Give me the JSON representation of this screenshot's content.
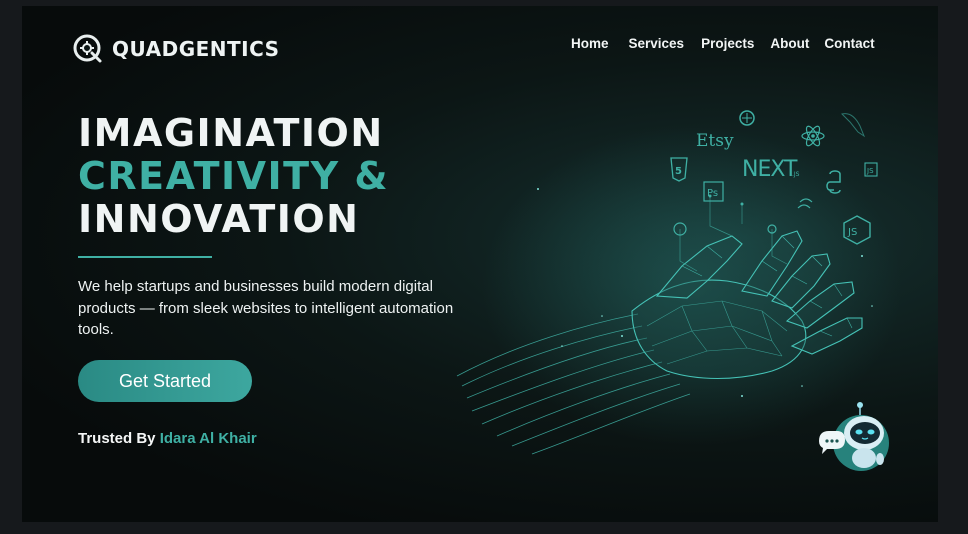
{
  "brand": {
    "name": "QUADGENTICS",
    "logo_icon": "q-gear-logo-icon"
  },
  "nav": {
    "items": [
      {
        "label": "Home"
      },
      {
        "label": "Services"
      },
      {
        "label": "Projects"
      },
      {
        "label": "About"
      },
      {
        "label": "Contact"
      }
    ]
  },
  "hero": {
    "line1": "IMAGINATION",
    "line2": "CREATIVITY &",
    "line3": "INNOVATION",
    "description": "We help startups and businesses build modern digital products — from sleek websites to intelligent automation tools.",
    "cta_label": "Get Started",
    "trusted_label": "Trusted By",
    "trusted_name": "Idara Al Khair"
  },
  "illustration": {
    "tech_labels": {
      "etsy": "Etsy",
      "next": "NEXT",
      "next_sub": ".JS",
      "ps": "Ps",
      "js": "JS",
      "html": "5",
      "jsbadge": "JS"
    },
    "icons": [
      "openai-icon",
      "react-icon",
      "mysql-dolphin-icon",
      "html5-icon",
      "photoshop-icon",
      "python-icon",
      "tailwind-icon",
      "nodejs-icon",
      "js-badge-icon",
      "robotic-hand-illustration",
      "chatbot-icon"
    ]
  },
  "colors": {
    "accent": "#3fb0a4",
    "background": "#0c1615",
    "page": "#16191c"
  }
}
